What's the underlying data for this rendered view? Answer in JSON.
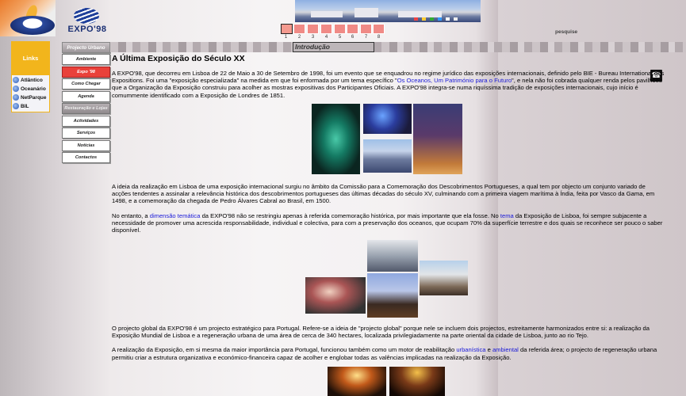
{
  "logos": {
    "expo_text": "EXPO'98"
  },
  "page_numbers": [
    "1",
    "2",
    "3",
    "4",
    "5",
    "6",
    "7",
    "8"
  ],
  "search_label": "pesquise",
  "links": {
    "title": "Links",
    "items": [
      {
        "label": "Atlântico"
      },
      {
        "label": "Oceanário"
      },
      {
        "label": "NetParque"
      },
      {
        "label": "BIL"
      }
    ]
  },
  "nav": {
    "header": "Projecto Urbano",
    "items": [
      {
        "label": "Ambiente"
      },
      {
        "label": "Expo '98"
      },
      {
        "label": "Como Chegar"
      },
      {
        "label": "Agenda"
      },
      {
        "label": "Restauração e Lojas"
      },
      {
        "label": "Actividades"
      },
      {
        "label": "Serviços"
      },
      {
        "label": "Notícias"
      },
      {
        "label": "Contactos"
      }
    ]
  },
  "section_tab": "Introdução",
  "article": {
    "title": "A Última Exposição do Século XX",
    "p1_a": "A EXPO'98, que decorreu em Lisboa de 22 de Maio a 30 de Setembro de 1998, foi um evento que se enquadrou no regime jurídico das exposições internacionais, definido pelo BIE - Bureau International des Expositions. Foi uma \"exposição especializada\" na medida em que foi enformada por um tema específico \"",
    "p1_link": "Os Oceanos, Um Património para o Futuro",
    "p1_b": "\", e nela não foi cobrada qualquer renda pelos pavilhões que a Organização da Exposição construiu para acolher as mostras expositivas dos Participantes Oficiais. A EXPO'98 integra-se numa riquíssima tradição de exposições internacionais, cujo início é comummente identificado com a Exposição de Londres de 1851.",
    "p2": "A ideia da realização em Lisboa de uma exposição internacional surgiu no âmbito da Comissão para a Comemoração dos Descobrimentos Portugueses, a qual tem por objecto um conjunto variado de acções tendentes a assinalar a relevância histórica dos descobrimentos portugueses das últimas décadas do século XV, culminando com a primeira viagem marítima à Índia, feita por Vasco da Gama, em 1498, e a comemoração da chegada de Pedro Álvares Cabral ao Brasil, em 1500.",
    "p3_a": "No entanto, a ",
    "p3_link1": "dimensão temática",
    "p3_b": " da EXPO'98 não se restringiu apenas à referida comemoração histórica, por mais importante que ela fosse. No ",
    "p3_link2": "tema",
    "p3_c": " da Exposição de Lisboa, foi sempre subjacente a necessidade de promover uma acrescida responsabilidade, individual e colectiva, para com a preservação dos oceanos, que ocupam 70% da superfície terrestre e dos quais se reconhece ser pouco o saber disponível.",
    "p4": "O projecto global da EXPO'98 é um projecto estratégico para Portugal. Refere-se a ideia de \"projecto global\" porque nele se incluem dois projectos, estreitamente harmonizados entre si: a realização da Exposição Mundial de Lisboa e a regeneração urbana de uma área de cerca de 340 hectares, localizada privilegiadamente na parte oriental da cidade de Lisboa, junto ao rio Tejo.",
    "p5_a": "A realização da Exposição, em si mesma da maior importância para Portugal, funcionou também como um motor de reabilitação ",
    "p5_link1": "urbanística",
    "p5_b": " e ",
    "p5_link2": "ambiental",
    "p5_c": " da referida área; o projecto de regeneração urbana permitiu criar a estrutura organizativa e económico-financeira capaz de acolher e englobar todas as valências implicadas na realização da Exposição."
  },
  "colors": {
    "accent": "#e9413a",
    "links_box": "#f2b51c",
    "link": "#1a1ad8"
  }
}
